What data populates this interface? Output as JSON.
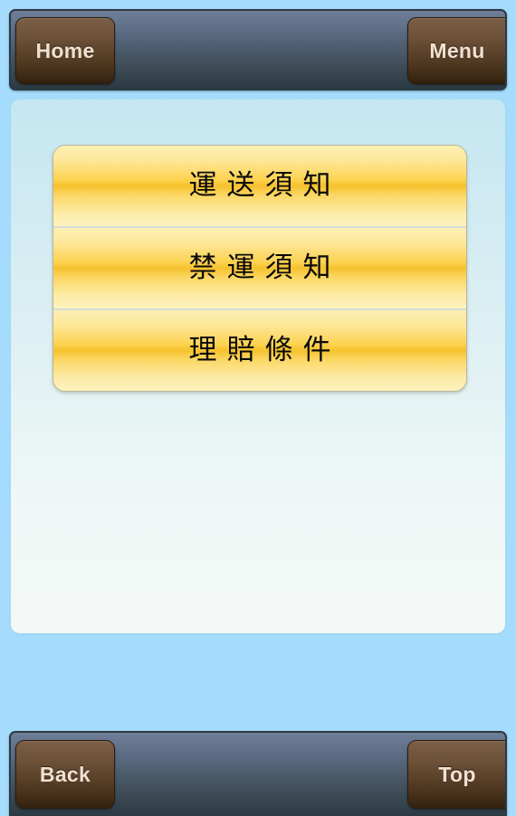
{
  "app": {
    "background_color": "#a5dcfd",
    "accent_gold": "#f6c12d",
    "bar_color": "#44535f",
    "button_color": "#4e371f"
  },
  "top_bar": {
    "home_label": "Home",
    "menu_label": "Menu"
  },
  "bottom_bar": {
    "back_label": "Back",
    "top_label": "Top"
  },
  "content": {
    "menu_items": [
      {
        "label": "運送須知"
      },
      {
        "label": "禁運須知"
      },
      {
        "label": "理賠條件"
      }
    ]
  }
}
